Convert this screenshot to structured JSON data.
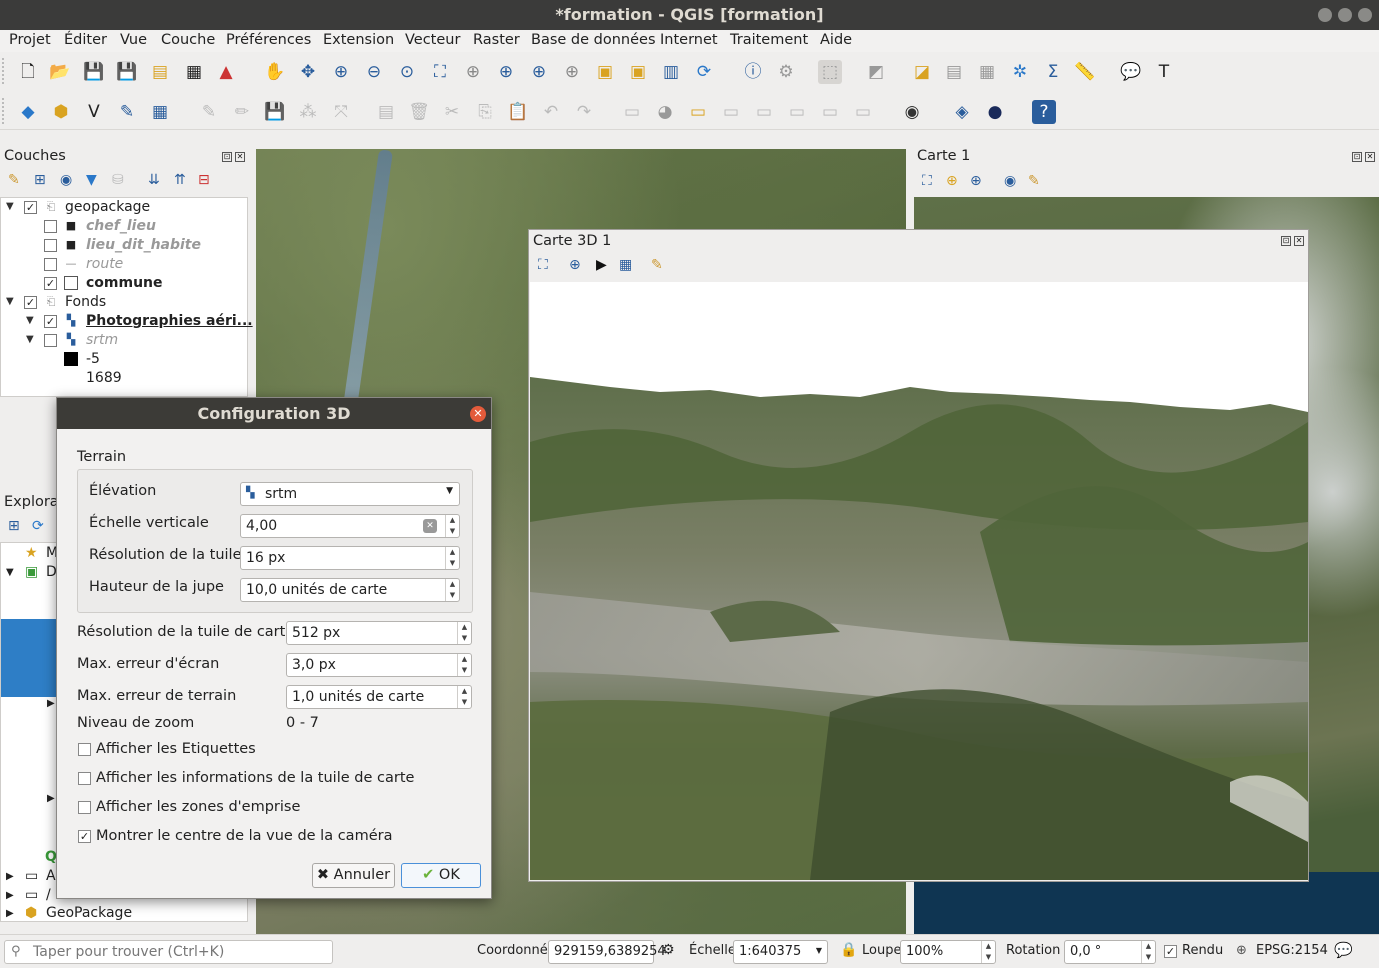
{
  "window": {
    "title": "*formation - QGIS [formation]"
  },
  "menu": [
    "Projet",
    "Éditer",
    "Vue",
    "Couche",
    "Préférences",
    "Extension",
    "Vecteur",
    "Raster",
    "Base de données",
    "Internet",
    "Traitement",
    "Aide"
  ],
  "panels": {
    "layers_title": "Couches",
    "browser_title": "Explora",
    "carte1_title": "Carte 1",
    "carte3d_title": "Carte 3D 1"
  },
  "layers": [
    {
      "label": "geopackage",
      "checked": true,
      "style": "normal"
    },
    {
      "label": "chef_lieu",
      "checked": false,
      "style": "italic"
    },
    {
      "label": "lieu_dit_habite",
      "checked": false,
      "style": "italic"
    },
    {
      "label": "route",
      "checked": false,
      "style": "italic"
    },
    {
      "label": "commune",
      "checked": true,
      "style": "bold"
    },
    {
      "label": "Fonds",
      "checked": true,
      "style": "normal"
    },
    {
      "label": "Photographies aéri...",
      "checked": true,
      "style": "bold-underline"
    },
    {
      "label": "srtm",
      "checked": false,
      "style": "italic"
    },
    {
      "label": "-5",
      "style": "legend"
    },
    {
      "label": "1689",
      "style": "legend"
    }
  ],
  "browser": {
    "items": [
      "M",
      "D",
      "A",
      "/",
      "GeoPackage"
    ]
  },
  "dialog": {
    "title": "Configuration 3D",
    "terrain_label": "Terrain",
    "elevation_label": "Élévation",
    "elevation_value": "srtm",
    "vertical_scale_label": "Échelle verticale",
    "vertical_scale_value": "4,00",
    "tile_res_label": "Résolution de la tuile",
    "tile_res_value": "16 px",
    "skirt_label": "Hauteur de la jupe",
    "skirt_value": "10,0 unités de carte",
    "map_tile_res_label": "Résolution de la tuile de carte",
    "map_tile_res_value": "512 px",
    "screen_err_label": "Max. erreur d'écran",
    "screen_err_value": "3,0 px",
    "ground_err_label": "Max. erreur de terrain",
    "ground_err_value": "1,0 unités de carte",
    "zoom_label": "Niveau de zoom",
    "zoom_value": "0 - 7",
    "show_labels": "Afficher les Etiquettes",
    "show_tile_info": "Afficher les informations de la tuile de carte",
    "show_bbox": "Afficher les zones d'emprise",
    "show_camera_center": "Montrer le centre de la vue de la caméra",
    "show_camera_center_checked": true,
    "cancel": "Annuler",
    "ok": "OK"
  },
  "status": {
    "search_placeholder": "Taper pour trouver (Ctrl+K)",
    "coord_label": "Coordonnée",
    "coord_value": "929159,6389254",
    "scale_label": "Échelle",
    "scale_value": "1:640375",
    "magnifier_label": "Loupe",
    "magnifier_value": "100%",
    "rotation_label": "Rotation",
    "rotation_value": "0,0 °",
    "render_label": "Rendu",
    "crs": "EPSG:2154"
  }
}
